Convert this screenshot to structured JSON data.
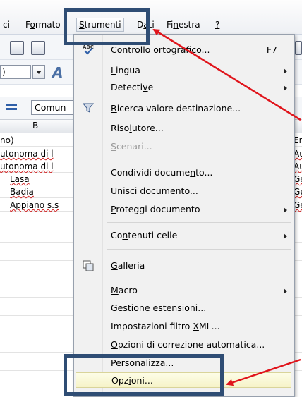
{
  "menubar": {
    "items": [
      {
        "pre": "",
        "u": "",
        "post": "ci"
      },
      {
        "pre": "F",
        "u": "o",
        "post": "rmato"
      },
      {
        "pre": "",
        "u": "S",
        "post": "trumenti"
      },
      {
        "pre": "D",
        "u": "a",
        "post": "ti"
      },
      {
        "pre": "Fi",
        "u": "n",
        "post": "estra"
      },
      {
        "pre": "",
        "u": "?",
        "post": ""
      }
    ]
  },
  "toolbar": {
    "zoom_value": ")",
    "style_value": "Comun"
  },
  "sheet": {
    "column_b": "B",
    "col_a_cells": [
      "no)",
      "utonoma di l",
      "utonoma di l",
      "",
      "",
      ""
    ],
    "col_b_cells": [
      "",
      "",
      "",
      "Lasa",
      "Badia",
      "Appiano s.s"
    ],
    "right_cells": [
      "En",
      "Au",
      "Au",
      "Ge",
      "Ge",
      "Ge"
    ]
  },
  "menu": {
    "items": [
      {
        "pre": "",
        "u": "C",
        "post": "ontrollo ortografico...",
        "shortcut": "F7"
      },
      {
        "pre": "",
        "u": "L",
        "post": "ingua"
      },
      {
        "pre": "Detecti",
        "u": "v",
        "post": "e"
      },
      {
        "pre": "",
        "u": "R",
        "post": "icerca valore destinazione..."
      },
      {
        "pre": "Riso",
        "u": "l",
        "post": "utore..."
      },
      {
        "pre": "",
        "u": "S",
        "post": "cenari..."
      },
      {
        "pre": "Condividi docume",
        "u": "n",
        "post": "to..."
      },
      {
        "pre": "Unisci ",
        "u": "d",
        "post": "ocumento..."
      },
      {
        "pre": "",
        "u": "P",
        "post": "roteggi documento"
      },
      {
        "pre": "Co",
        "u": "n",
        "post": "tenuti celle"
      },
      {
        "pre": "",
        "u": "G",
        "post": "alleria"
      },
      {
        "pre": "",
        "u": "M",
        "post": "acro"
      },
      {
        "pre": "Gestione ",
        "u": "e",
        "post": "stensioni..."
      },
      {
        "pre": "Impostazioni filtro ",
        "u": "X",
        "post": "ML..."
      },
      {
        "pre": "",
        "u": "O",
        "post": "pzioni di correzione automatica..."
      },
      {
        "pre": "",
        "u": "P",
        "post": "ersonalizza..."
      },
      {
        "pre": "Opz",
        "u": "i",
        "post": "oni..."
      }
    ]
  },
  "colors": {
    "annotation_box": "#2f4d74",
    "annotation_arrow": "#e0141b",
    "highlight": "#f6f3c8"
  }
}
